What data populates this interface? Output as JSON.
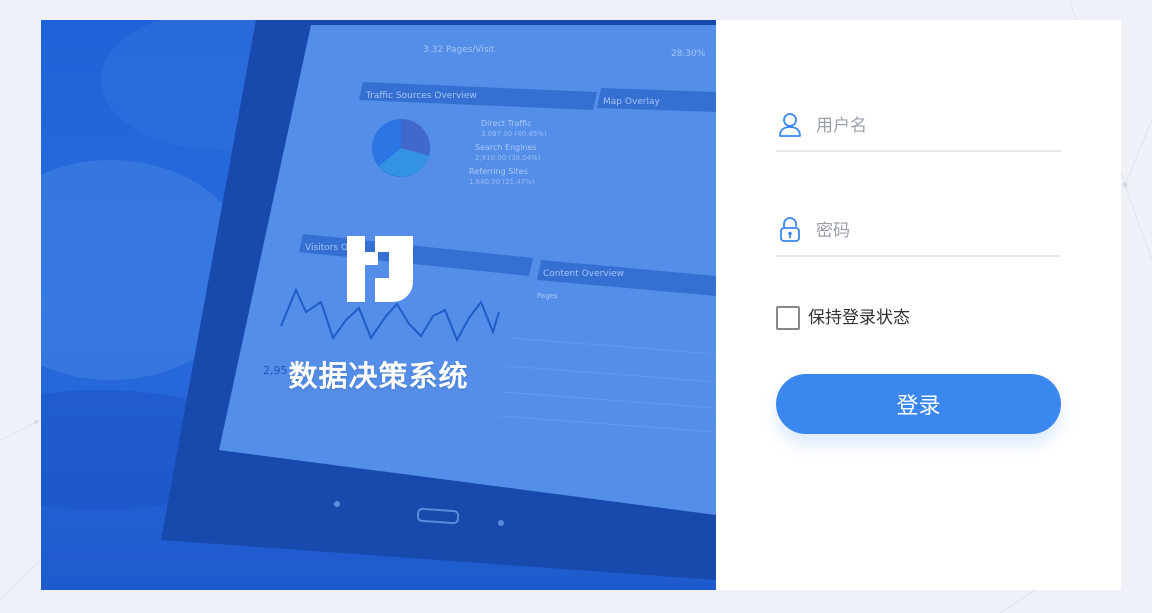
{
  "brand": {
    "title": "数据决策系统",
    "logo_icon": "brand-logo-icon"
  },
  "hero_screen": {
    "pages_visit": "3.32 Pages/Visit",
    "bounce": "28.30%",
    "traffic_title": "Traffic Sources Overview",
    "map_title": "Map Overlay",
    "visitors_title": "Visitors O",
    "visitors_value": "2,95",
    "content_title": "Content Overview",
    "content_page": "Pages",
    "legend": [
      {
        "label": "Direct Traffic",
        "value": "3,087.00 (40.45%)"
      },
      {
        "label": "Search Engines",
        "value": "2,910.00 (38.04%)"
      },
      {
        "label": "Referring Sites",
        "value": "1,640.00 (21.47%)"
      }
    ]
  },
  "login": {
    "username": {
      "placeholder": "用户名",
      "icon": "user-icon",
      "value": ""
    },
    "password": {
      "placeholder": "密码",
      "icon": "lock-icon",
      "value": ""
    },
    "remember_label": "保持登录状态",
    "remember_checked": false,
    "submit_label": "登录"
  },
  "colors": {
    "primary": "#3b87f0",
    "hero_blue": "#2a6fe0",
    "background": "#eef1f7",
    "input_line": "#e6e8ed"
  }
}
